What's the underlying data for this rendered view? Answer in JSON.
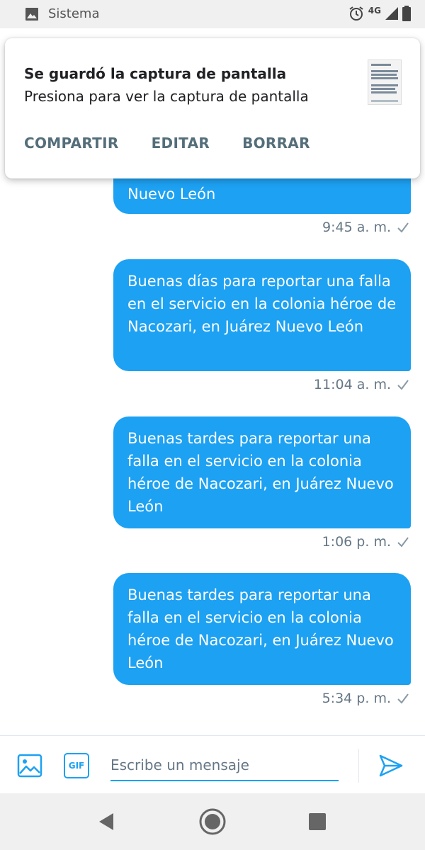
{
  "status_bar": {
    "app_name": "Sistema",
    "network": "4G",
    "icons": [
      "image-icon",
      "alarm-icon",
      "signal-icon",
      "battery-icon"
    ]
  },
  "notification": {
    "title": "Se guardó la captura de pantalla",
    "subtitle": "Presiona para ver la captura de pantalla",
    "actions": [
      "COMPARTIR",
      "EDITAR",
      "BORRAR"
    ],
    "icons": [
      "screenshot-thumbnail"
    ]
  },
  "messages": [
    {
      "text": "Nuevo León",
      "time": "9:45 a. m."
    },
    {
      "text": "Buenas días para reportar una falla en el servicio en la colonia héroe de Nacozari, en Juárez Nuevo León",
      "time": "11:04 a. m."
    },
    {
      "text": "Buenas tardes para reportar una falla en el servicio en la colonia héroe de Nacozari, en Juárez Nuevo León",
      "time": "1:06 p. m."
    },
    {
      "text": "Buenas tardes para reportar una falla en el servicio en la colonia héroe de Nacozari, en Juárez Nuevo León",
      "time": "5:34 p. m."
    }
  ],
  "compose": {
    "placeholder": "Escribe un mensaje",
    "gif_label": "GIF",
    "icons": [
      "image-icon",
      "gif-icon",
      "send-icon"
    ]
  },
  "navigation": {
    "icons": [
      "back-icon",
      "home-icon",
      "recents-icon"
    ]
  },
  "colors": {
    "accent": "#1da1f2",
    "meta_text": "#657786",
    "notification_action": "#546e7a"
  }
}
